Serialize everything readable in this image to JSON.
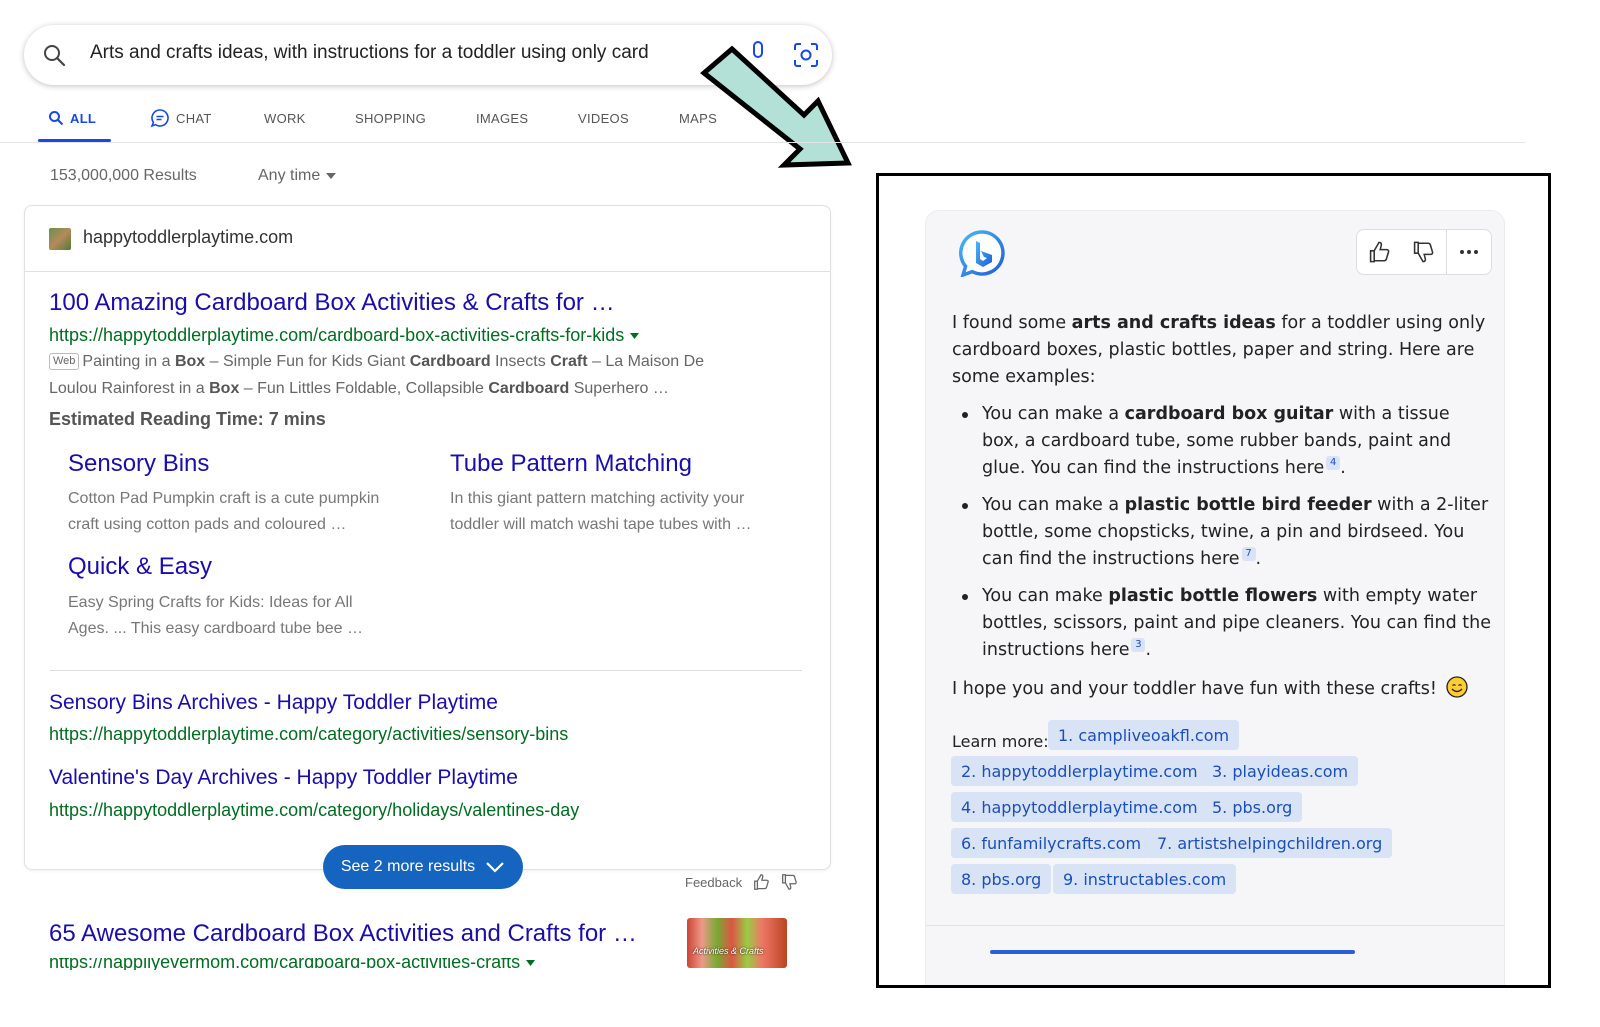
{
  "search": {
    "query": "Arts and crafts ideas, with instructions for a toddler using only card"
  },
  "tabs": [
    {
      "label": "ALL",
      "active": true
    },
    {
      "label": "CHAT"
    },
    {
      "label": "WORK"
    },
    {
      "label": "SHOPPING"
    },
    {
      "label": "IMAGES"
    },
    {
      "label": "VIDEOS"
    },
    {
      "label": "MAPS"
    }
  ],
  "results_meta": {
    "count": "153,000,000 Results",
    "time_filter": "Any time"
  },
  "top_result": {
    "site": "happytoddlerplaytime.com",
    "title": "100 Amazing Cardboard Box Activities & Crafts for …",
    "url": "https://happytoddlerplaytime.com/cardboard-box-activities-crafts-for-kids",
    "web_tag": "Web",
    "snippet_parts": {
      "s1": "Painting in a ",
      "b1": "Box",
      "s2": " – Simple Fun for Kids Giant ",
      "b2": "Cardboard",
      "s3": " Insects ",
      "b3": "Craft",
      "s4": " – La Maison De",
      "s5": "Loulou Rainforest in a ",
      "b4": "Box",
      "s6": " – Fun Littles Foldable, Collapsible ",
      "b5": "Cardboard",
      "s7": " Superhero …"
    },
    "reading_time": "Estimated Reading Time: 7 mins",
    "deep_links": [
      {
        "title": "Sensory Bins",
        "line1": "Cotton Pad Pumpkin craft is a cute pumpkin",
        "line2": "craft using cotton pads and coloured …"
      },
      {
        "title": "Tube Pattern Matching",
        "line1": "In this giant pattern matching activity your",
        "line2": "toddler will match washi tape tubes with …"
      },
      {
        "title": "Quick & Easy",
        "line1": "Easy Spring Crafts for Kids: Ideas for All",
        "line2": "Ages. ... This easy cardboard tube bee …"
      }
    ],
    "sub_results": [
      {
        "title": "Sensory Bins Archives - Happy Toddler Playtime",
        "url": "https://happytoddlerplaytime.com/category/activities/sensory-bins"
      },
      {
        "title": "Valentine's Day Archives - Happy Toddler Playtime",
        "url": "https://happytoddlerplaytime.com/category/holidays/valentines-day"
      }
    ],
    "see_more": "See 2 more results",
    "feedback": "Feedback"
  },
  "next_result": {
    "title": "65 Awesome Cardboard Box Activities and Crafts for …",
    "url": "https://happilyevermom.com/cardboard-box-activities-crafts",
    "thumb_text": "Activities & Crafts"
  },
  "chat": {
    "intro": {
      "p1": "I found some ",
      "b1": "arts and crafts ideas",
      "p2": " for a toddler using only cardboard boxes, plastic bottles, paper and string. Here are some examples:"
    },
    "items": [
      {
        "pre": "You can make a ",
        "bold": "cardboard box guitar",
        "post": " with a tissue box, a cardboard tube, some rubber bands, paint and glue. You can find the instructions here",
        "cite": "4"
      },
      {
        "pre": "You can make a ",
        "bold": "plastic bottle bird feeder",
        "post": " with a 2-liter bottle, some chopsticks, twine, a pin and birdseed. You can find the instructions here",
        "cite": "7"
      },
      {
        "pre": "You can make ",
        "bold": "plastic bottle flowers",
        "post": " with empty water bottles, scissors, paint and pipe cleaners. You can find the instructions here",
        "cite": "3"
      }
    ],
    "outro": "I hope you and your toddler have fun with these crafts!",
    "learn_more_label": "Learn more:",
    "sources": [
      "1. campliveoakfl.com",
      "2. happytoddlerplaytime.com",
      "3. playideas.com",
      "4. happytoddlerplaytime.com",
      "5. pbs.org",
      "6. funfamilycrafts.com",
      "7. artistshelpingchildren.org",
      "8. pbs.org",
      "9. instructables.com"
    ]
  },
  "colors": {
    "link": "#1a0dab",
    "url": "#006d21",
    "accent": "#174ae4",
    "arrow_fill": "#b3e0d7",
    "source_chip": "#d9e3f6"
  }
}
